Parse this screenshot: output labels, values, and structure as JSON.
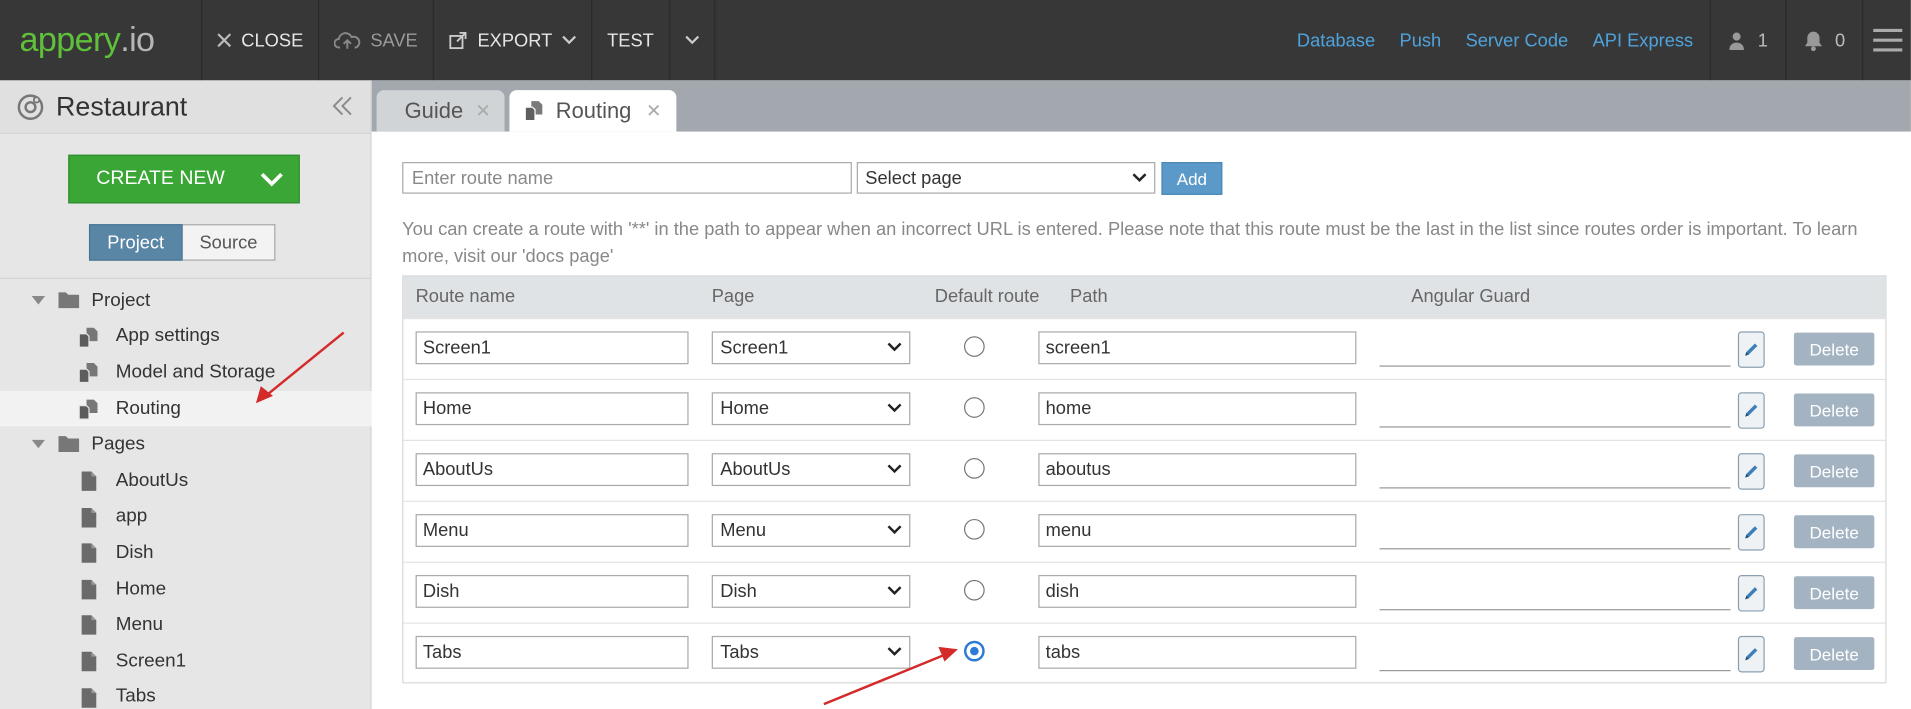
{
  "topbar": {
    "logo_main": "appery",
    "logo_suffix": ".io",
    "close_label": "CLOSE",
    "save_label": "SAVE",
    "export_label": "EXPORT",
    "test_label": "TEST",
    "links": [
      "Database",
      "Push",
      "Server Code",
      "API Express"
    ],
    "user_count": "1",
    "notification_count": "0"
  },
  "sidebar": {
    "project_name": "Restaurant",
    "create_new_label": "CREATE NEW",
    "toggle": {
      "project": "Project",
      "source": "Source"
    },
    "tree": [
      {
        "label": "Project",
        "level": 0,
        "type": "folder"
      },
      {
        "label": "App settings",
        "level": 1,
        "type": "file"
      },
      {
        "label": "Model and Storage",
        "level": 1,
        "type": "file"
      },
      {
        "label": "Routing",
        "level": 1,
        "type": "file",
        "selected": true
      },
      {
        "label": "Pages",
        "level": 0,
        "type": "folder"
      },
      {
        "label": "AboutUs",
        "level": 1,
        "type": "page"
      },
      {
        "label": "app",
        "level": 1,
        "type": "page"
      },
      {
        "label": "Dish",
        "level": 1,
        "type": "page"
      },
      {
        "label": "Home",
        "level": 1,
        "type": "page"
      },
      {
        "label": "Menu",
        "level": 1,
        "type": "page"
      },
      {
        "label": "Screen1",
        "level": 1,
        "type": "page"
      },
      {
        "label": "Tabs",
        "level": 1,
        "type": "page"
      }
    ]
  },
  "tabs": {
    "guide": "Guide",
    "routing": "Routing"
  },
  "routing": {
    "route_name_placeholder": "Enter route name",
    "select_page_label": "Select page",
    "add_label": "Add",
    "info_text": "You can create a route with '**' in the path to appear when an incorrect URL is entered. Please note that this route must be the last in the list since routes order is important. To learn more, visit our 'docs page'",
    "headers": {
      "route_name": "Route name",
      "page": "Page",
      "default_route": "Default route",
      "path": "Path",
      "guard": "Angular Guard"
    },
    "delete_label": "Delete",
    "rows": [
      {
        "name": "Screen1",
        "page": "Screen1",
        "path": "screen1",
        "default": false
      },
      {
        "name": "Home",
        "page": "Home",
        "path": "home",
        "default": false
      },
      {
        "name": "AboutUs",
        "page": "AboutUs",
        "path": "aboutus",
        "default": false
      },
      {
        "name": "Menu",
        "page": "Menu",
        "path": "menu",
        "default": false
      },
      {
        "name": "Dish",
        "page": "Dish",
        "path": "dish",
        "default": false
      },
      {
        "name": "Tabs",
        "page": "Tabs",
        "path": "tabs",
        "default": true
      }
    ]
  },
  "colors": {
    "brand_green": "#5fc03a",
    "link_blue": "#4fa3dc",
    "arrow_red": "#d42a2a",
    "radio_blue": "#2b7bd6"
  }
}
